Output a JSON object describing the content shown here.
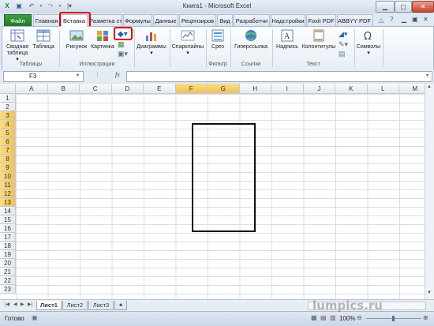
{
  "window": {
    "title": "Книга1 - Microsoft Excel"
  },
  "tabs": [
    {
      "label": "Файл"
    },
    {
      "label": "Главная"
    },
    {
      "label": "Вставка"
    },
    {
      "label": "Разметка ст"
    },
    {
      "label": "Формулы"
    },
    {
      "label": "Данные"
    },
    {
      "label": "Рецензиров"
    },
    {
      "label": "Вид"
    },
    {
      "label": "Разработчи"
    },
    {
      "label": "Надстройки"
    },
    {
      "label": "Foxit PDF"
    },
    {
      "label": "ABBYY PDF T"
    }
  ],
  "ribbon": {
    "pivot_label_1": "Сводная",
    "pivot_label_2": "таблица",
    "table_label": "Таблица",
    "picture_label": "Рисунок",
    "clipart_label": "Картинка",
    "charts_label": "Диаграммы",
    "sparklines_label": "Спарклайны",
    "slicer_label": "Срез",
    "hyperlink_label": "Гиперссылка",
    "textbox_label": "Надпись",
    "headerfooter_label": "Колонтитулы",
    "symbols_label": "Символы",
    "groups": {
      "tables": "Таблицы",
      "illustrations": "Иллюстрации",
      "filter": "Фильтр",
      "links": "Ссылки",
      "text": "Текст"
    }
  },
  "formula_bar": {
    "name_box": "F3",
    "fx": "fx",
    "value": ""
  },
  "grid": {
    "columns": [
      "A",
      "B",
      "C",
      "D",
      "E",
      "F",
      "G",
      "H",
      "I",
      "J",
      "K",
      "L",
      "M"
    ],
    "rows": [
      "1",
      "2",
      "3",
      "4",
      "5",
      "6",
      "7",
      "8",
      "9",
      "10",
      "11",
      "12",
      "13",
      "14",
      "15",
      "16",
      "17",
      "18",
      "19",
      "20",
      "21",
      "22",
      "23"
    ],
    "selected_columns": [
      "F",
      "G"
    ],
    "selected_rows": [
      "3",
      "4",
      "5",
      "6",
      "7",
      "8",
      "9",
      "10",
      "11",
      "12",
      "13"
    ]
  },
  "sheets": [
    {
      "label": "Лист1",
      "active": true
    },
    {
      "label": "Лист2",
      "active": false
    },
    {
      "label": "Лист3",
      "active": false
    }
  ],
  "status": {
    "ready": "Готово",
    "zoom": "100%"
  },
  "watermark": "lumpics.ru",
  "colors": {
    "file_tab": "#2a8a34",
    "highlight": "#e00000",
    "selected_header": "#f5cf6f"
  }
}
